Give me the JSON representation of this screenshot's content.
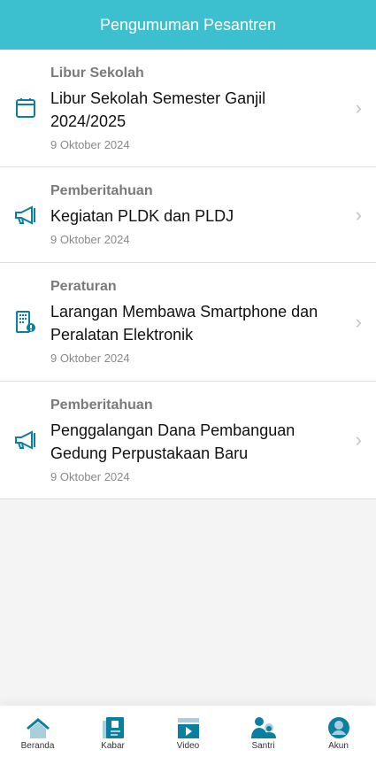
{
  "header": {
    "title": "Pengumuman Pesantren"
  },
  "announcements": [
    {
      "category": "Libur Sekolah",
      "title": "Libur Sekolah Semester Ganjil 2024/2025",
      "date": "9 Oktober 2024",
      "icon": "calendar-icon"
    },
    {
      "category": "Pemberitahuan",
      "title": "Kegiatan PLDK dan PLDJ",
      "date": "9 Oktober 2024",
      "icon": "megaphone-icon"
    },
    {
      "category": "Peraturan",
      "title": "Larangan Membawa Smartphone dan Peralatan Elektronik",
      "date": "9 Oktober 2024",
      "icon": "building-alert-icon"
    },
    {
      "category": "Pemberitahuan",
      "title": "Penggalangan Dana Pembanguan Gedung Perpustakaan Baru",
      "date": "9 Oktober 2024",
      "icon": "megaphone-icon"
    }
  ],
  "nav": [
    {
      "label": "Beranda"
    },
    {
      "label": "Kabar"
    },
    {
      "label": "Video"
    },
    {
      "label": "Santri"
    },
    {
      "label": "Akun"
    }
  ],
  "colors": {
    "header": "#3cc0d0",
    "icon": "#0b7fa0"
  }
}
